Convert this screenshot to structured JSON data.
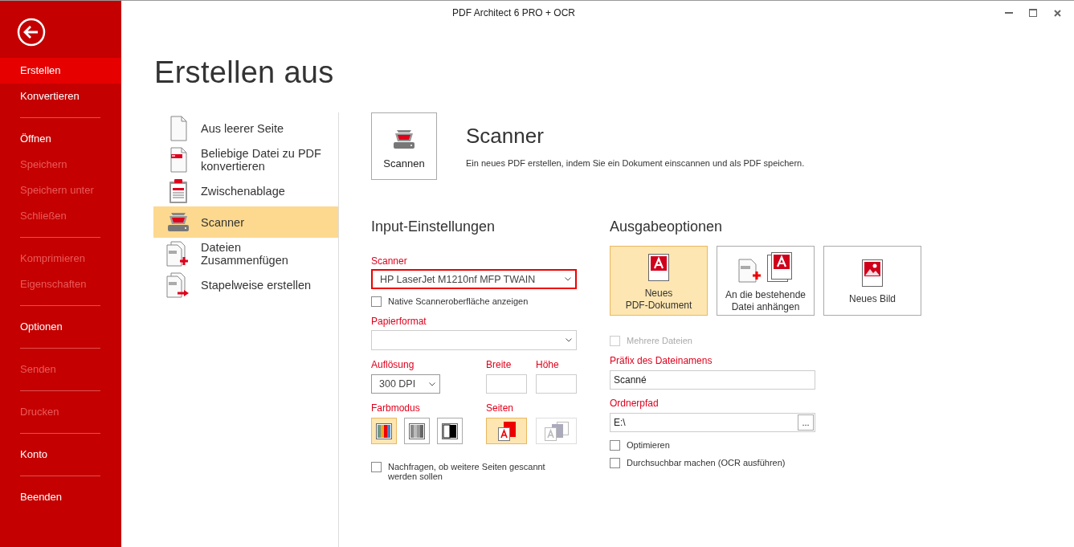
{
  "window": {
    "title": "PDF Architect 6 PRO + OCR"
  },
  "sidebar": {
    "groups": [
      {
        "items": [
          {
            "label": "Erstellen",
            "selected": true,
            "disabled": false
          },
          {
            "label": "Konvertieren",
            "selected": false,
            "disabled": false
          }
        ]
      },
      {
        "items": [
          {
            "label": "Öffnen",
            "selected": false,
            "disabled": false
          },
          {
            "label": "Speichern",
            "selected": false,
            "disabled": true
          },
          {
            "label": "Speichern unter",
            "selected": false,
            "disabled": true
          },
          {
            "label": "Schließen",
            "selected": false,
            "disabled": true
          }
        ]
      },
      {
        "items": [
          {
            "label": "Komprimieren",
            "selected": false,
            "disabled": true
          },
          {
            "label": "Eigenschaften",
            "selected": false,
            "disabled": true
          }
        ]
      },
      {
        "items": [
          {
            "label": "Optionen",
            "selected": false,
            "disabled": false
          }
        ]
      },
      {
        "items": [
          {
            "label": "Senden",
            "selected": false,
            "disabled": true
          }
        ]
      },
      {
        "items": [
          {
            "label": "Drucken",
            "selected": false,
            "disabled": true
          }
        ]
      },
      {
        "items": [
          {
            "label": "Konto",
            "selected": false,
            "disabled": false
          }
        ]
      },
      {
        "items": [
          {
            "label": "Beenden",
            "selected": false,
            "disabled": false
          }
        ]
      }
    ]
  },
  "page_title": "Erstellen aus",
  "create_options": [
    {
      "kind": "blank",
      "lines": [
        "Aus leerer Seite"
      ],
      "selected": false
    },
    {
      "kind": "convert",
      "lines": [
        "Beliebige Datei zu PDF",
        "konvertieren"
      ],
      "selected": false
    },
    {
      "kind": "clipboard",
      "lines": [
        "Zwischenablage"
      ],
      "selected": false
    },
    {
      "kind": "scanner",
      "lines": [
        "Scanner"
      ],
      "selected": true
    },
    {
      "kind": "merge",
      "lines": [
        "Dateien",
        "Zusammenfügen"
      ],
      "selected": false
    },
    {
      "kind": "batch",
      "lines": [
        "Stapelweise erstellen"
      ],
      "selected": false
    }
  ],
  "tool": {
    "button": "Scannen",
    "title": "Scanner",
    "description": "Ein neues PDF erstellen, indem Sie ein Dokument einscannen und als PDF speichern."
  },
  "input_settings": {
    "heading": "Input-Einstellungen",
    "scanner": {
      "label": "Scanner",
      "value": "HP LaserJet M1210nf MFP TWAIN",
      "focused": true
    },
    "native_ui": {
      "label": "Native Scanneroberfläche anzeigen",
      "checked": false
    },
    "paper_format": {
      "label": "Papierformat"
    },
    "resolution": {
      "label": "Auflösung",
      "value": "300 DPI"
    },
    "width": {
      "label": "Breite"
    },
    "height": {
      "label": "Höhe"
    },
    "color_mode": {
      "label": "Farbmodus",
      "options": [
        {
          "kind": "color",
          "selected": true
        },
        {
          "kind": "gray",
          "selected": false
        },
        {
          "kind": "bw",
          "selected": false
        }
      ]
    },
    "pages": {
      "label": "Seiten",
      "options": [
        {
          "kind": "single",
          "selected": true,
          "disabled": false
        },
        {
          "kind": "multiple",
          "selected": false,
          "disabled": true
        }
      ]
    },
    "ask_more": {
      "label": "Nachfragen, ob weitere Seiten gescannt werden sollen",
      "checked": false
    }
  },
  "output_options": {
    "heading": "Ausgabeoptionen",
    "targets": [
      {
        "kind": "new_pdf",
        "lines": [
          "Neues",
          "PDF-Dokument"
        ],
        "selected": true
      },
      {
        "kind": "append",
        "lines": [
          "An die bestehende",
          "Datei anhängen"
        ],
        "selected": false
      },
      {
        "kind": "image",
        "lines": [
          "Neues Bild"
        ],
        "selected": false
      }
    ],
    "multiple_files": {
      "label": "Mehrere Dateien",
      "checked": false,
      "disabled": true
    },
    "prefix": {
      "label": "Präfix des Dateinamens",
      "value": "Scanné"
    },
    "folder": {
      "label": "Ordnerpfad",
      "value": "E:\\",
      "browse": "..."
    },
    "optimize": {
      "label": "Optimieren",
      "checked": false
    },
    "ocr": {
      "label": "Durchsuchbar machen (OCR ausführen)",
      "checked": false
    }
  }
}
